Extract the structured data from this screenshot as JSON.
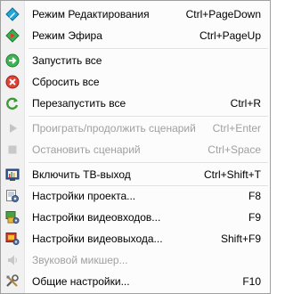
{
  "menu": {
    "items": [
      {
        "label": "Режим Редактирования",
        "shortcut": "Ctrl+PageDown",
        "icon": "edit-mode-icon",
        "disabled": false
      },
      {
        "label": "Режим Эфира",
        "shortcut": "Ctrl+PageUp",
        "icon": "air-mode-icon",
        "disabled": false
      },
      {
        "label": "Запустить все",
        "shortcut": "",
        "icon": "start-all-icon",
        "disabled": false
      },
      {
        "label": "Сбросить все",
        "shortcut": "",
        "icon": "reset-all-icon",
        "disabled": false
      },
      {
        "label": "Перезапустить все",
        "shortcut": "Ctrl+R",
        "icon": "restart-all-icon",
        "disabled": false
      },
      {
        "label": "Проиграть/продолжить сценарий",
        "shortcut": "Ctrl+Enter",
        "icon": "play-icon",
        "disabled": true
      },
      {
        "label": "Остановить сценарий",
        "shortcut": "Ctrl+Space",
        "icon": "stop-icon",
        "disabled": true
      },
      {
        "label": "Включить ТВ-выход",
        "shortcut": "Ctrl+Shift+T",
        "icon": "tv-output-icon",
        "disabled": false
      },
      {
        "label": "Настройки проекта...",
        "shortcut": "F8",
        "icon": "project-settings-icon",
        "disabled": false
      },
      {
        "label": "Настройки видеовходов...",
        "shortcut": "F9",
        "icon": "video-input-settings-icon",
        "disabled": false
      },
      {
        "label": "Настройки видеовыхода...",
        "shortcut": "Shift+F9",
        "icon": "video-output-settings-icon",
        "disabled": false
      },
      {
        "label": "Звуковой микшер...",
        "shortcut": "",
        "icon": "audio-mixer-icon",
        "disabled": true
      },
      {
        "label": "Общие настройки...",
        "shortcut": "F10",
        "icon": "tools-icon",
        "disabled": false
      }
    ]
  },
  "colors": {
    "disabled_text": "#a0a0a0",
    "edit_mode": "#1a9fd0",
    "air_mode": "#2db34a",
    "start": "#2fa84a",
    "reset": "#d23a2f",
    "restart": "#4a9a3a"
  }
}
